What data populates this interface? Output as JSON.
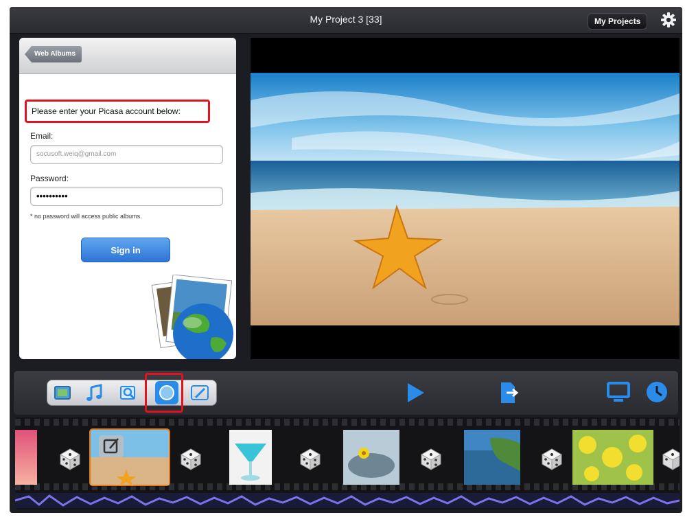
{
  "header": {
    "title": "My Project 3  [33]",
    "my_projects_label": "My Projects",
    "settings_icon": "gear-icon"
  },
  "picasa": {
    "back_label": "Web Albums",
    "prompt": "Please enter your Picasa account below:",
    "email_label": "Email:",
    "email_value": "socusoft.weiq@gmail.com",
    "password_label": "Password:",
    "password_value": "••••••••••",
    "note": "* no password will access public albums.",
    "signin_label": "Sign in",
    "illustration": "photos-globe-illustration"
  },
  "toolbar": {
    "segments": [
      "photo-icon",
      "music-icon",
      "search-photo-icon",
      "globe-icon",
      "pen-icon"
    ],
    "selected_segment": "globe-icon",
    "play_icon": "play-icon",
    "export_icon": "export-icon",
    "display_icon": "monitor-icon",
    "clock_icon": "clock-icon",
    "accent": "#2a8be8",
    "highlight_color": "#e0141e"
  },
  "timeline": {
    "clips": [
      "pink-sunset",
      "starfish-beach",
      "blue-cocktail",
      "yellow-flower-stone",
      "coast-cliff",
      "yellow-flowers"
    ],
    "selected_clip": "starfish-beach",
    "transition_icon": "dice-icon",
    "edit_icon": "edit-icon",
    "selected_border": "#e07a1a"
  }
}
